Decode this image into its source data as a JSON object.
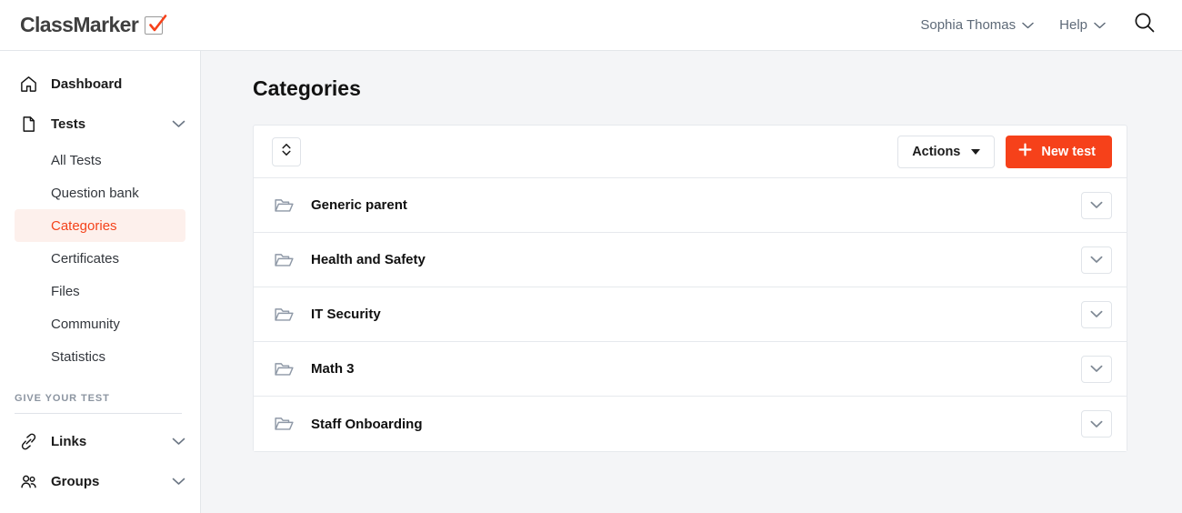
{
  "header": {
    "logo_text": "ClassMarker",
    "logo_icon": "checkbox-check-icon",
    "user_menu": "Sophia Thomas",
    "help_menu": "Help",
    "search_icon": "search-icon",
    "accent_color": "#f6411a"
  },
  "sidebar": {
    "primary": [
      {
        "label": "Dashboard",
        "icon": "home-icon",
        "has_caret": false
      },
      {
        "label": "Tests",
        "icon": "document-icon",
        "has_caret": true
      }
    ],
    "sub_items": [
      {
        "label": "All Tests",
        "active": false
      },
      {
        "label": "Question bank",
        "active": false
      },
      {
        "label": "Categories",
        "active": true
      },
      {
        "label": "Certificates",
        "active": false
      },
      {
        "label": "Files",
        "active": false
      },
      {
        "label": "Community",
        "active": false
      },
      {
        "label": "Statistics",
        "active": false
      }
    ],
    "section_label": "GIVE YOUR TEST",
    "secondary": [
      {
        "label": "Links",
        "icon": "link-icon",
        "has_caret": true
      },
      {
        "label": "Groups",
        "icon": "people-icon",
        "has_caret": true
      }
    ],
    "active_color": "#f4431b",
    "active_bg": "#fdf0ec"
  },
  "main": {
    "page_title": "Categories",
    "toolbar": {
      "sort_icon": "sort-updown-icon",
      "actions_label": "Actions",
      "actions_caret": "chevron-down-icon",
      "new_test_label": "New test",
      "new_test_icon": "plus-icon"
    },
    "categories": [
      {
        "name": "Generic parent",
        "icon": "folder-open-icon",
        "expand_icon": "chevron-down-icon"
      },
      {
        "name": "Health and Safety",
        "icon": "folder-open-icon",
        "expand_icon": "chevron-down-icon"
      },
      {
        "name": "IT Security",
        "icon": "folder-open-icon",
        "expand_icon": "chevron-down-icon"
      },
      {
        "name": "Math 3",
        "icon": "folder-open-icon",
        "expand_icon": "chevron-down-icon"
      },
      {
        "name": "Staff Onboarding",
        "icon": "folder-open-icon",
        "expand_icon": "chevron-down-icon"
      }
    ]
  }
}
